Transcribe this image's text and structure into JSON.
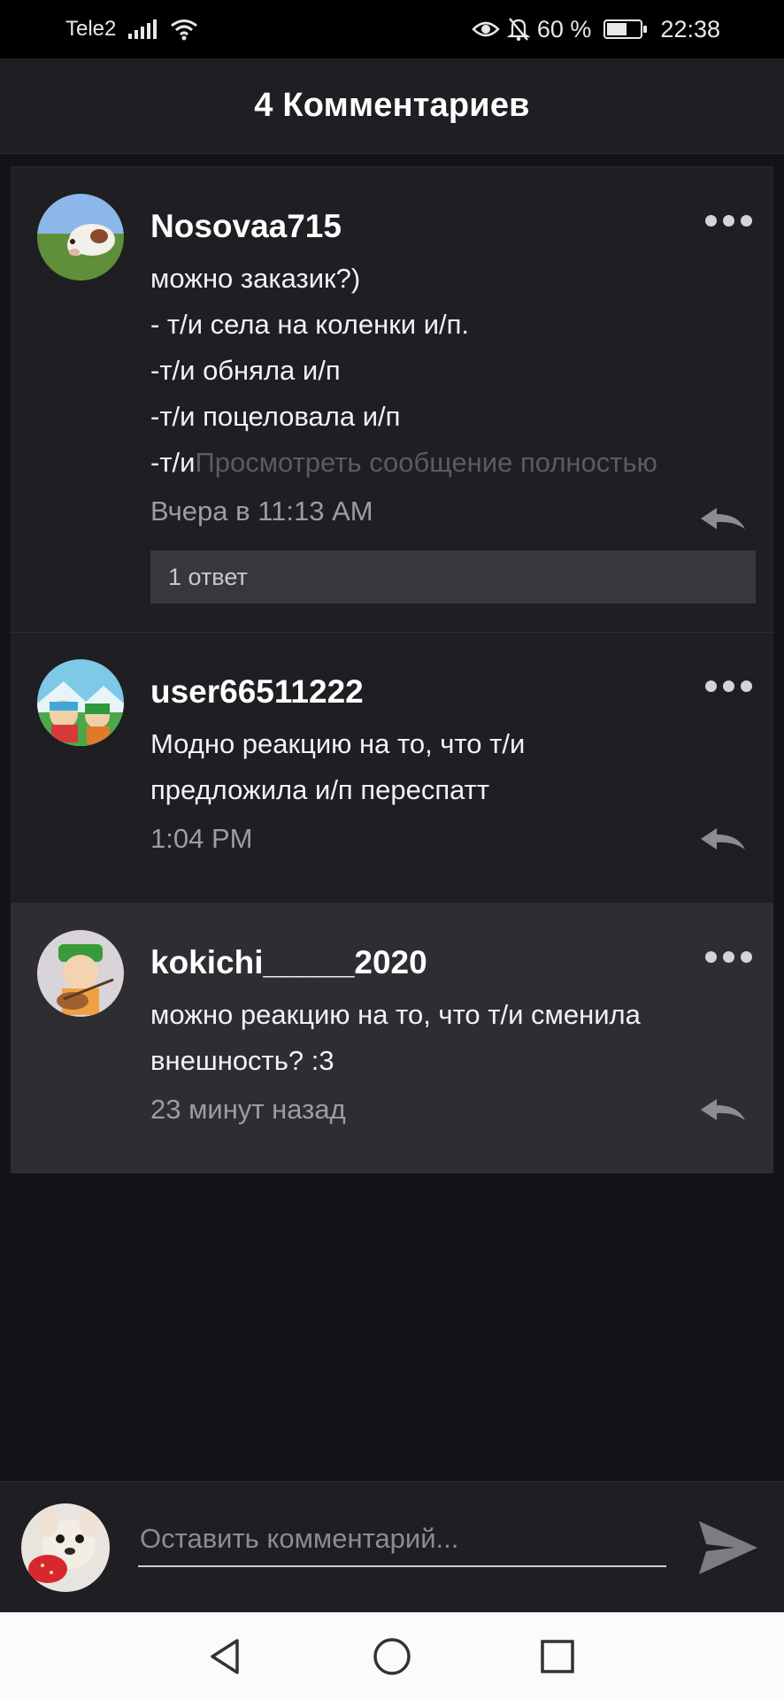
{
  "status_bar": {
    "carrier": "Tele2",
    "battery_percent": "60 %",
    "battery_level": 0.6,
    "time": "22:38"
  },
  "header": {
    "title": "4 Комментариев"
  },
  "comments": [
    {
      "username": "Nosovaa715",
      "lines": [
        "можно заказик?)",
        "- т/и села на коленки и/п.",
        "-т/и обняла и/п",
        "-т/и поцеловала и/п"
      ],
      "truncated_prefix": "-т/и",
      "view_full": "Просмотреть сообщение полностью",
      "timestamp": "Вчера в 11:13 AM",
      "replies": "1 ответ"
    },
    {
      "username": "user66511222",
      "lines": [
        "Модно реакцию на то, что т/и",
        "предложила и/п переспатт"
      ],
      "timestamp": "1:04 PM"
    },
    {
      "username": "kokichi_____2020",
      "lines": [
        "можно реакцию на то, что т/и сменила",
        "внешность? :3"
      ],
      "timestamp": "23 минут назад"
    }
  ],
  "composer": {
    "placeholder": "Оставить комментарий..."
  },
  "icons": {
    "more": "more-dots-icon",
    "reply": "reply-arrow-icon",
    "send": "send-icon",
    "nav_back": "triangle-back-icon",
    "nav_home": "circle-home-icon",
    "nav_recent": "square-recent-icon"
  },
  "colors": {
    "background": "#141317",
    "card": "#1f1e22",
    "card_highlight": "#2e2d32",
    "muted_text": "#9d9ca1",
    "navbar": "#fbfbfb"
  }
}
